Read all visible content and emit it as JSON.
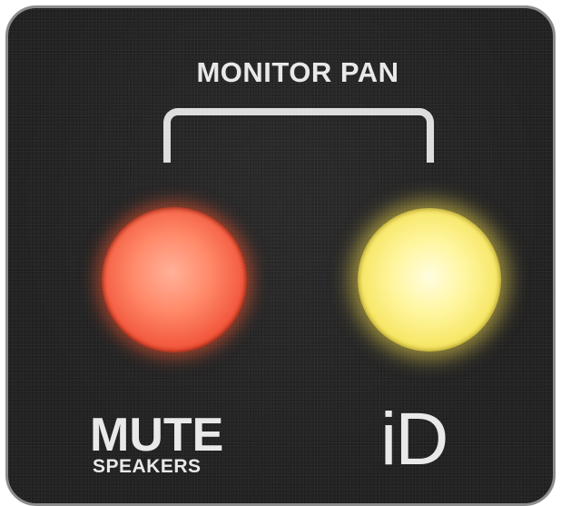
{
  "panel": {
    "pan_label": "MONITOR PAN",
    "mute": {
      "title": "MUTE",
      "subtitle": "SPEAKERS",
      "color": "#ff7a58"
    },
    "id_button": {
      "title": "iD",
      "color": "#fff39a"
    }
  }
}
